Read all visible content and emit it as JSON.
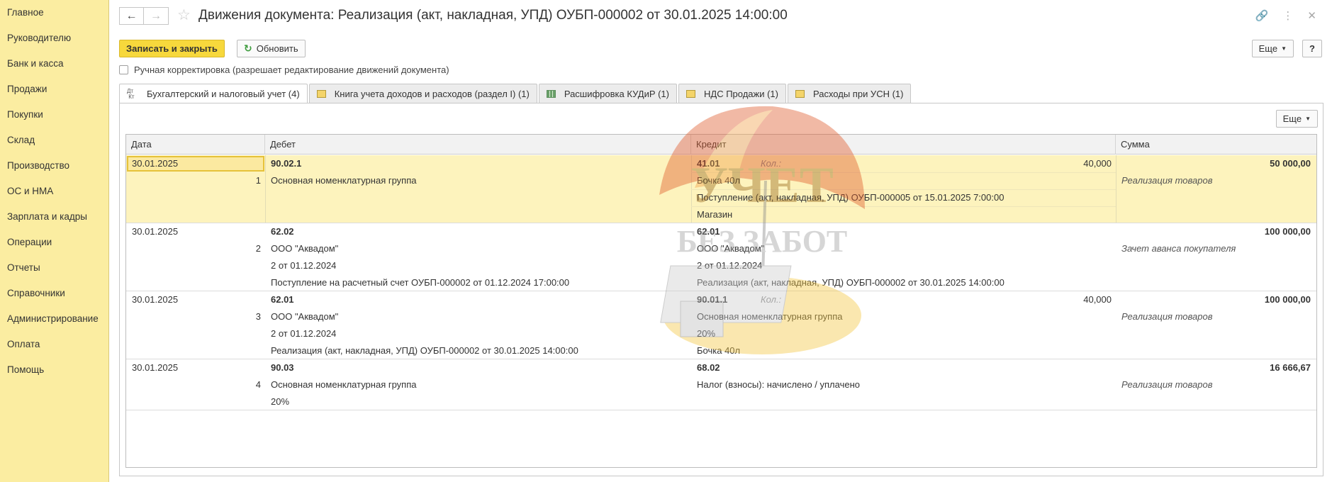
{
  "sidebar": {
    "items": [
      "Главное",
      "Руководителю",
      "Банк и касса",
      "Продажи",
      "Покупки",
      "Склад",
      "Производство",
      "ОС и НМА",
      "Зарплата и кадры",
      "Операции",
      "Отчеты",
      "Справочники",
      "Администрирование",
      "Оплата",
      "Помощь"
    ]
  },
  "header": {
    "title": "Движения документа: Реализация (акт, накладная, УПД) ОУБП-000002 от 30.01.2025 14:00:00",
    "back_icon": "arrow-left-icon",
    "forward_icon": "arrow-right-icon",
    "star_icon": "star-icon",
    "link_icon": "link-icon",
    "menu_icon": "more-vertical-icon",
    "close_icon": "close-icon"
  },
  "toolbar": {
    "save_close": "Записать и закрыть",
    "refresh": "Обновить",
    "more": "Еще",
    "help": "?"
  },
  "manual": {
    "label": "Ручная корректировка (разрешает редактирование движений документа)",
    "checked": false
  },
  "tabs": [
    {
      "label": "Бухгалтерский и налоговый учет (4)",
      "active": true,
      "icon": "dt-kt-icon"
    },
    {
      "label": "Книга учета доходов и расходов (раздел I) (1)",
      "active": false,
      "icon": "register-icon"
    },
    {
      "label": "Расшифровка КУДиР (1)",
      "active": false,
      "icon": "table-icon"
    },
    {
      "label": "НДС Продажи (1)",
      "active": false,
      "icon": "register-icon"
    },
    {
      "label": "Расходы при УСН (1)",
      "active": false,
      "icon": "register-icon"
    }
  ],
  "grid": {
    "more": "Еще",
    "columns": [
      "Дата",
      "Дебет",
      "Кредит",
      "Сумма"
    ],
    "rows": [
      {
        "date": "30.01.2025",
        "num": "1",
        "debit": [
          "90.02.1",
          "Основная номенклатурная группа"
        ],
        "credit": [
          "41.01",
          "Бочка 40л",
          "Поступление (акт, накладная, УПД) ОУБП-000005 от 15.01.2025 7:00:00",
          "Магазин"
        ],
        "qty_label": "Кол.:",
        "qty": "40,000",
        "sum": "50 000,00",
        "content": "Реализация товаров"
      },
      {
        "date": "30.01.2025",
        "num": "2",
        "debit": [
          "62.02",
          "ООО \"Аквадом\"",
          "2 от 01.12.2024",
          "Поступление на расчетный счет ОУБП-000002 от 01.12.2024 17:00:00"
        ],
        "credit": [
          "62.01",
          "ООО \"Аквадом\"",
          "2 от 01.12.2024",
          "Реализация (акт, накладная, УПД) ОУБП-000002 от 30.01.2025 14:00:00"
        ],
        "sum": "100 000,00",
        "content": "Зачет аванса покупателя"
      },
      {
        "date": "30.01.2025",
        "num": "3",
        "debit": [
          "62.01",
          "ООО \"Аквадом\"",
          "2 от 01.12.2024",
          "Реализация (акт, накладная, УПД) ОУБП-000002 от 30.01.2025 14:00:00"
        ],
        "credit": [
          "90.01.1",
          "Основная номенклатурная группа",
          "20%",
          "Бочка 40л"
        ],
        "qty_label": "Кол.:",
        "qty": "40,000",
        "sum": "100 000,00",
        "content": "Реализация товаров"
      },
      {
        "date": "30.01.2025",
        "num": "4",
        "debit": [
          "90.03",
          "Основная номенклатурная группа",
          "20%"
        ],
        "credit": [
          "68.02",
          "Налог (взносы): начислено / уплачено"
        ],
        "sum": "16 666,67",
        "content": "Реализация товаров"
      }
    ]
  },
  "watermark": {
    "line1": "УЧЕТ",
    "line2": "БЕЗ ЗАБОТ"
  },
  "colors": {
    "sidebar": "#fbeda1",
    "primary_button": "#f7d83c",
    "selected_row": "#fdf3bd"
  }
}
